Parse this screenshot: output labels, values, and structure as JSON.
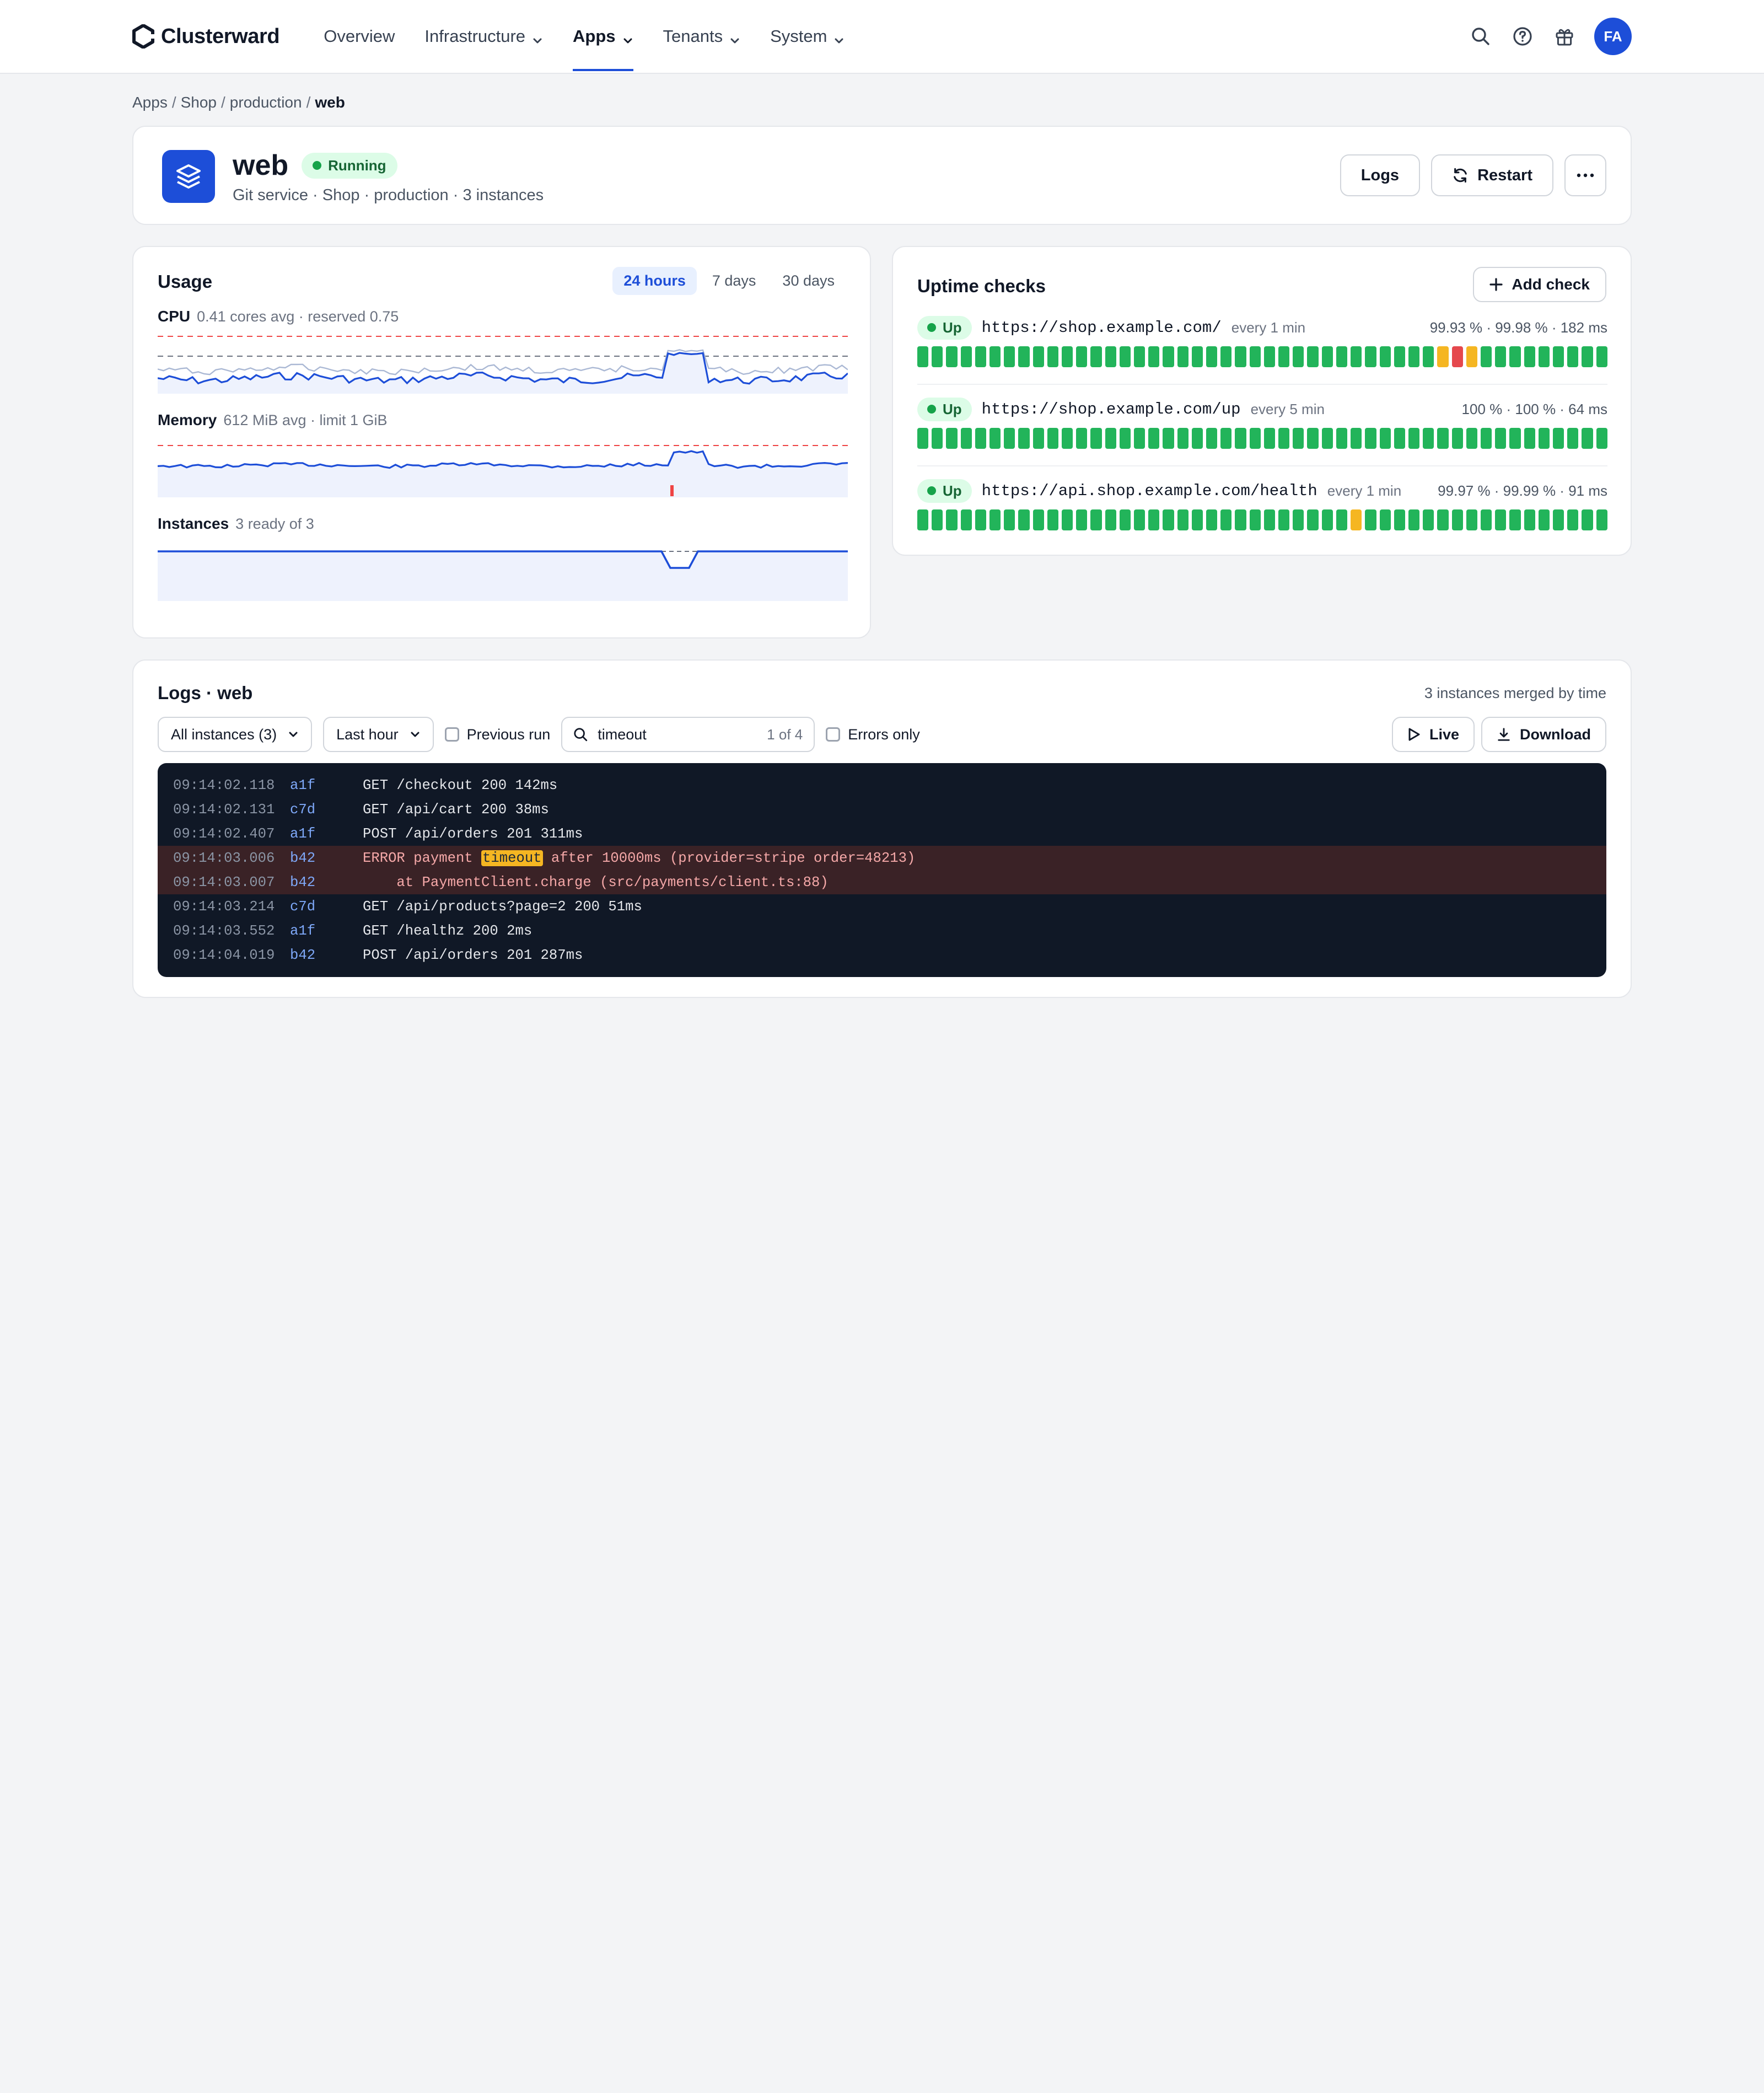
{
  "brand": {
    "name": "Clusterward"
  },
  "nav": {
    "items": [
      {
        "label": "Overview",
        "has_menu": false,
        "active": false
      },
      {
        "label": "Infrastructure",
        "has_menu": true,
        "active": false
      },
      {
        "label": "Apps",
        "has_menu": true,
        "active": true
      },
      {
        "label": "Tenants",
        "has_menu": true,
        "active": false
      },
      {
        "label": "System",
        "has_menu": true,
        "active": false
      }
    ],
    "user_initials": "FA",
    "icons": [
      "search-icon",
      "help-icon",
      "gift-icon"
    ]
  },
  "breadcrumb": [
    "Apps",
    "Shop",
    "production",
    "web"
  ],
  "app": {
    "name": "web",
    "status": "Running",
    "subtitle": "Git service · Shop · production · 3 instances",
    "actions": {
      "logs": "Logs",
      "restart": "Restart"
    }
  },
  "usage": {
    "title": "Usage",
    "ranges": [
      "24 hours",
      "7 days",
      "30 days"
    ],
    "active_range": "24 hours",
    "metrics": {
      "cpu": {
        "name": "CPU",
        "detail": "0.41 cores avg · reserved 0.75"
      },
      "memory": {
        "name": "Memory",
        "detail": "612 MiB avg · limit 1 GiB"
      },
      "instances": {
        "name": "Instances",
        "detail": "3 ready of 3"
      }
    }
  },
  "uptime": {
    "title": "Uptime checks",
    "add_label": "Add check",
    "checks": [
      {
        "status": "Up",
        "url": "https://shop.example.com/",
        "frequency": "every 1 min",
        "stats": "99.93 % · 99.98 % · 182 ms",
        "history": [
          "ok",
          "ok",
          "ok",
          "ok",
          "ok",
          "ok",
          "ok",
          "ok",
          "ok",
          "ok",
          "ok",
          "ok",
          "ok",
          "ok",
          "ok",
          "ok",
          "ok",
          "ok",
          "ok",
          "ok",
          "ok",
          "ok",
          "ok",
          "ok",
          "ok",
          "ok",
          "ok",
          "ok",
          "ok",
          "ok",
          "ok",
          "ok",
          "ok",
          "ok",
          "ok",
          "ok",
          "warn",
          "down",
          "warn",
          "ok",
          "ok",
          "ok",
          "ok",
          "ok",
          "ok",
          "ok",
          "ok",
          "ok"
        ]
      },
      {
        "status": "Up",
        "url": "https://shop.example.com/up",
        "frequency": "every 5 min",
        "stats": "100 % · 100 % · 64 ms",
        "history": [
          "ok",
          "ok",
          "ok",
          "ok",
          "ok",
          "ok",
          "ok",
          "ok",
          "ok",
          "ok",
          "ok",
          "ok",
          "ok",
          "ok",
          "ok",
          "ok",
          "ok",
          "ok",
          "ok",
          "ok",
          "ok",
          "ok",
          "ok",
          "ok",
          "ok",
          "ok",
          "ok",
          "ok",
          "ok",
          "ok",
          "ok",
          "ok",
          "ok",
          "ok",
          "ok",
          "ok",
          "ok",
          "ok",
          "ok",
          "ok",
          "ok",
          "ok",
          "ok",
          "ok",
          "ok",
          "ok",
          "ok",
          "ok"
        ]
      },
      {
        "status": "Up",
        "url": "https://api.shop.example.com/health",
        "frequency": "every 1 min",
        "stats": "99.97 % · 99.99 % · 91 ms",
        "history": [
          "ok",
          "ok",
          "ok",
          "ok",
          "ok",
          "ok",
          "ok",
          "ok",
          "ok",
          "ok",
          "ok",
          "ok",
          "ok",
          "ok",
          "ok",
          "ok",
          "ok",
          "ok",
          "ok",
          "ok",
          "ok",
          "ok",
          "ok",
          "ok",
          "ok",
          "ok",
          "ok",
          "ok",
          "ok",
          "ok",
          "warn",
          "ok",
          "ok",
          "ok",
          "ok",
          "ok",
          "ok",
          "ok",
          "ok",
          "ok",
          "ok",
          "ok",
          "ok",
          "ok",
          "ok",
          "ok",
          "ok",
          "ok"
        ]
      }
    ],
    "colors": {
      "ok": "#22b45a",
      "warn": "#f5b622",
      "down": "#e5484d"
    }
  },
  "logs": {
    "title": "Logs · web",
    "meta": "3 instances merged by time",
    "instance_filter": "All instances (3)",
    "time_filter": "Last hour",
    "previous_run_label": "Previous run",
    "search_value": "timeout",
    "search_count": "1 of 4",
    "errors_only_label": "Errors only",
    "live_label": "Live",
    "download_label": "Download",
    "lines": [
      {
        "time": "09:14:02.118",
        "inst": "a1f",
        "pre": "GET /checkout 200 142ms",
        "hl": "",
        "post": "",
        "error": false
      },
      {
        "time": "09:14:02.131",
        "inst": "c7d",
        "pre": "GET /api/cart 200 38ms",
        "hl": "",
        "post": "",
        "error": false
      },
      {
        "time": "09:14:02.407",
        "inst": "a1f",
        "pre": "POST /api/orders 201 311ms",
        "hl": "",
        "post": "",
        "error": false
      },
      {
        "time": "09:14:03.006",
        "inst": "b42",
        "pre": "ERROR payment ",
        "hl": "timeout",
        "post": " after 10000ms (provider=stripe order=48213)",
        "error": true
      },
      {
        "time": "09:14:03.007",
        "inst": "b42",
        "pre": "    at PaymentClient.charge (src/payments/client.ts:88)",
        "hl": "",
        "post": "",
        "error": true
      },
      {
        "time": "09:14:03.214",
        "inst": "c7d",
        "pre": "GET /api/products?page=2 200 51ms",
        "hl": "",
        "post": "",
        "error": false
      },
      {
        "time": "09:14:03.552",
        "inst": "a1f",
        "pre": "GET /healthz 200 2ms",
        "hl": "",
        "post": "",
        "error": false
      },
      {
        "time": "09:14:04.019",
        "inst": "b42",
        "pre": "POST /api/orders 201 287ms",
        "hl": "",
        "post": "",
        "error": false
      }
    ]
  },
  "colors": {
    "accent": "#1d4ed8",
    "running": "#16a34a"
  }
}
